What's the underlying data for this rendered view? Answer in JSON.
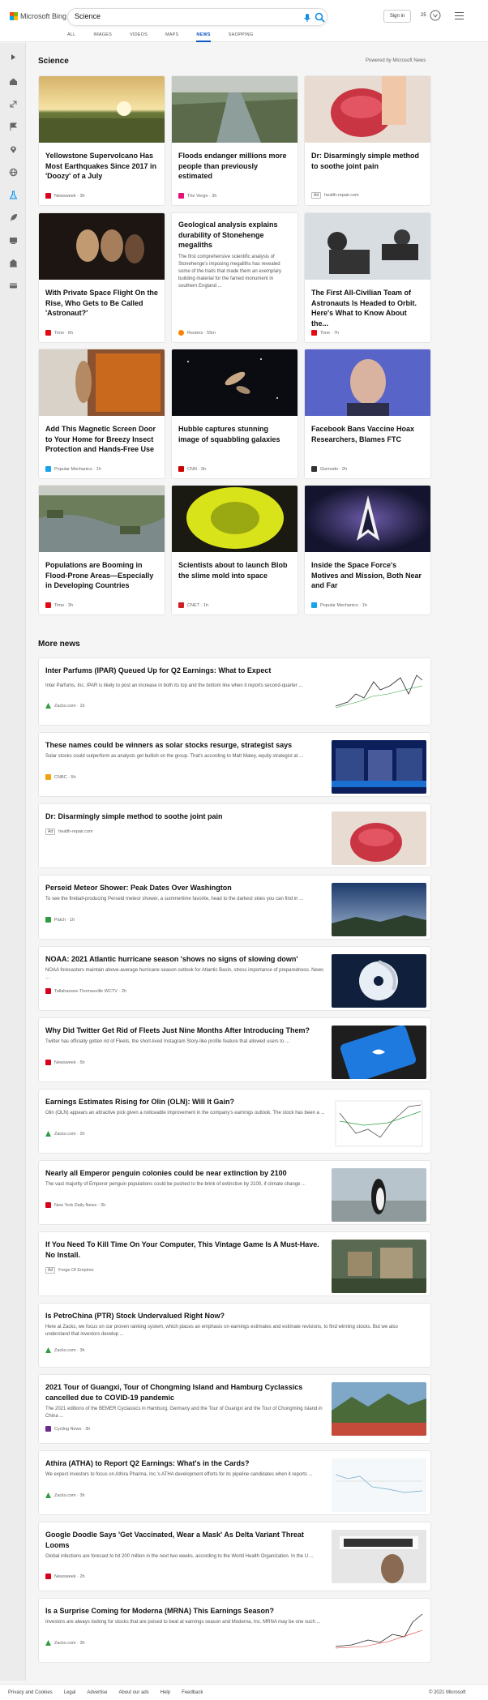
{
  "header": {
    "logo_text": "Microsoft Bing",
    "search_value": "Science",
    "signin": "Sign in",
    "rewards_count": "25",
    "tabs": [
      {
        "label": "ALL"
      },
      {
        "label": "IMAGES"
      },
      {
        "label": "VIDEOS"
      },
      {
        "label": "MAPS"
      },
      {
        "label": "NEWS"
      },
      {
        "label": "SHOPPING"
      }
    ]
  },
  "section": {
    "title": "Science",
    "powered": "Powered by Microsoft News"
  },
  "cards": [
    {
      "title": "Yellowstone Supervolcano Has Most Earthquakes Since 2017 in 'Doozy' of a July",
      "source": "Newsweek",
      "time": "3h",
      "badge": "#d9001b"
    },
    {
      "title": "Floods endanger millions more people than previously estimated",
      "source": "The Verge",
      "time": "3h",
      "badge": "#e2127a"
    },
    {
      "title": "Dr: Disarmingly simple method to soothe joint pain",
      "ad": "Ad",
      "source": "health-repair.com",
      "time": "",
      "badge": ""
    },
    {
      "title": "With Private Space Flight On the Rise, Who Gets to Be Called 'Astronaut?'",
      "source": "Time",
      "time": "6h",
      "badge": "#e50914"
    },
    {
      "title": "Geological analysis explains durability of Stonehenge megaliths",
      "snippet": "The first comprehensive scientific analysis of Stonehenge's imposing megaliths has revealed some of the traits that made them an exemplary building material for the famed monument in southern England ...",
      "source": "Reuters",
      "time": "55m",
      "badge": "#ff8000"
    },
    {
      "title": "The First All-Civilian Team of Astronauts Is Headed to Orbit. Here's What to Know About the...",
      "source": "Time",
      "time": "7h",
      "badge": "#e50914"
    },
    {
      "title": "Add This Magnetic Screen Door to Your Home for Breezy Insect Protection and Hands-Free Use",
      "source": "Popular Mechanics",
      "time": "1h",
      "badge": "#1aa3e8"
    },
    {
      "title": "Hubble captures stunning image of squabbling galaxies",
      "source": "CNN",
      "time": "3h",
      "badge": "#cc0000"
    },
    {
      "title": "Facebook Bans Vaccine Hoax Researchers, Blames FTC",
      "source": "Gizmodo",
      "time": "2h",
      "badge": "#333333"
    },
    {
      "title": "Populations are Booming in Flood-Prone Areas—Especially in Developing Countries",
      "source": "Time",
      "time": "3h",
      "badge": "#e50914"
    },
    {
      "title": "Scientists about to launch Blob the slime mold into space",
      "source": "CNET",
      "time": "1h",
      "badge": "#d11f26"
    },
    {
      "title": "Inside the Space Force's Motives and Mission, Both Near and Far",
      "source": "Popular Mechanics",
      "time": "1h",
      "badge": "#1aa3e8"
    }
  ],
  "more_news": {
    "title": "More news",
    "items": [
      {
        "title": "Inter Parfums (IPAR) Queued Up for Q2 Earnings: What to Expect",
        "snippet": "Inter Parfums, Inc. IPAR is likely to post an increase in both its top and the bottom line when it reports second-quarter ...",
        "source": "Zacks.com",
        "time": "1h",
        "badge": "#2e9c3f"
      },
      {
        "title": "These names could be winners as solar stocks resurge, strategist says",
        "snippet": "Solar stocks could outperform as analysts get bullish on the group. That's according to Matt Maley, equity strategist at ...",
        "source": "CNBC",
        "time": "5h",
        "badge": "#f0a30a"
      },
      {
        "title": "Dr: Disarmingly simple method to soothe joint pain",
        "snippet": "",
        "ad": "Ad",
        "source": "health-repair.com",
        "time": "",
        "badge": ""
      },
      {
        "title": "Perseid Meteor Shower: Peak Dates Over Washington",
        "snippet": "To see the fireball-producing Perseid meteor shower, a summertime favorite, head to the darkest skies you can find in ...",
        "source": "Patch",
        "time": "1h",
        "badge": "#2e9c3f"
      },
      {
        "title": "NOAA: 2021 Atlantic hurricane season 'shows no signs of slowing down'",
        "snippet": "NOAA forecasters maintain above-average hurricane season outlook for Atlantic Basin, stress importance of preparedness. News ...",
        "source": "Tallahassee-Thomasville WCTV",
        "time": "2h",
        "badge": "#d9001b"
      },
      {
        "title": "Why Did Twitter Get Rid of Fleets Just Nine Months After Introducing Them?",
        "snippet": "Twitter has officially gotten rid of Fleets, the short-lived Instagram Story-like profile feature that allowed users to ...",
        "source": "Newsweek",
        "time": "5h",
        "badge": "#d9001b"
      },
      {
        "title": "Earnings Estimates Rising for Olin (OLN): Will It Gain?",
        "snippet": "Olin (OLN) appears an attractive pick given a noticeable improvement in the company's earnings outlook. The stock has been a ...",
        "source": "Zacks.com",
        "time": "2h",
        "badge": "#2e9c3f"
      },
      {
        "title": "Nearly all Emperor penguin colonies could be near extinction by 2100",
        "snippet": "The vast majority of Emperor penguin populations could be pushed to the brink of extinction by 2100, if climate change ...",
        "source": "New York Daily News",
        "time": "3h",
        "badge": "#d9001b"
      },
      {
        "title": "If You Need To Kill Time On Your Computer, This Vintage Game Is A Must-Have. No Install.",
        "snippet": "",
        "ad": "Ad",
        "source": "Forge Of Empires",
        "time": "",
        "badge": ""
      },
      {
        "title": "Is PetroChina (PTR) Stock Undervalued Right Now?",
        "snippet": "Here at Zacks, we focus on our proven ranking system, which places an emphasis on earnings estimates and estimate revisions, to find winning stocks. But we also understand that investors develop ...",
        "source": "Zacks.com",
        "time": "3h",
        "badge": "#2e9c3f"
      },
      {
        "title": "2021 Tour of Guangxi, Tour of Chongming Island and Hamburg Cyclassics cancelled due to COVID-19 pandemic",
        "snippet": "The 2021 editions of the BEMER Cyclassics in Hamburg, Germany and the Tour of Guangxi and the Tour of Chongming Island in China ...",
        "source": "Cycling News",
        "time": "3h",
        "badge": "#6a2c91"
      },
      {
        "title": "Athira (ATHA) to Report Q2 Earnings: What's in the Cards?",
        "snippet": "We expect investors to focus on Athira Pharma, Inc.'s ATHA development efforts for its pipeline candidates when it reports ...",
        "source": "Zacks.com",
        "time": "3h",
        "badge": "#2e9c3f"
      },
      {
        "title": "Google Doodle Says 'Get Vaccinated, Wear a Mask' As Delta Variant Threat Looms",
        "snippet": "Global infections are forecast to hit 200 million in the next two weeks, according to the World Health Organization. In the U ...",
        "source": "Newsweek",
        "time": "2h",
        "badge": "#d9001b"
      },
      {
        "title": "Is a Surprise Coming for Moderna (MRNA) This Earnings Season?",
        "snippet": "Investors are always looking for stocks that are poised to beat at earnings season and Moderna, Inc. MRNA may be one such ...",
        "source": "Zacks.com",
        "time": "3h",
        "badge": "#2e9c3f"
      }
    ]
  },
  "footer": {
    "links": [
      "Privacy and Cookies",
      "Legal",
      "Advertise",
      "About our ads",
      "Help",
      "Feedback"
    ],
    "copyright": "© 2021 Microsoft"
  },
  "sidebar_icons": [
    "expand-icon",
    "home-icon",
    "resize-icon",
    "flag-icon",
    "location-icon",
    "globe-icon",
    "science-icon",
    "rocket-icon",
    "tv-icon",
    "building-icon",
    "card-icon"
  ]
}
